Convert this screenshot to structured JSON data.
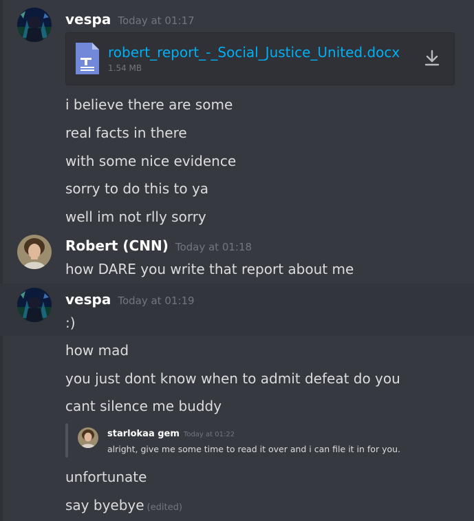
{
  "colors": {
    "background": "#36393f",
    "highlight": "#32353b",
    "username": "#ffffff",
    "timestamp": "#72767d",
    "link": "#00b0f4",
    "file_icon": "#7289da"
  },
  "group1": {
    "username": "vespa",
    "timestamp": "Today at 01:17",
    "attachment": {
      "filename": "robert_report_-_Social_Justice_United.docx",
      "size": "1.54 MB",
      "icon": "document-icon",
      "action_icon": "download-icon"
    },
    "lines": [
      "i believe there are some",
      "real facts in there",
      "with some nice evidence",
      "sorry to do this to ya",
      "well im not rlly sorry"
    ]
  },
  "group2": {
    "username": "Robert (CNN)",
    "timestamp": "Today at 01:18",
    "lines": [
      "how DARE you write that report about me"
    ]
  },
  "group3": {
    "username": "vespa",
    "timestamp": "Today at 01:19",
    "lines": [
      ":)",
      "how mad",
      "you just dont know when to admit defeat do you",
      "cant silence me buddy"
    ],
    "embed": {
      "author": "starlokaa gem",
      "timestamp": "Today at 01:22",
      "text": "alright, give me some time to read it over and i can file it in for you."
    },
    "after_lines": [
      "unfortunate",
      "say byebye"
    ],
    "edited_label": "(edited)"
  }
}
